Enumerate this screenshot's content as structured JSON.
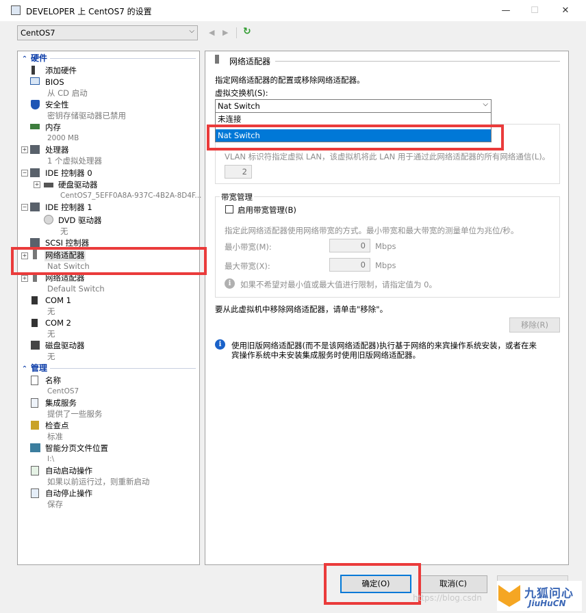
{
  "window": {
    "title": "DEVELOPER 上 CentOS7 的设置",
    "min": "—",
    "max": "☐",
    "close": "✕"
  },
  "vm_selector": {
    "value": "CentOS7"
  },
  "tree": {
    "hardware_header": "硬件",
    "mgmt_header": "管理",
    "items": [
      {
        "label": "添加硬件",
        "sub": ""
      },
      {
        "label": "BIOS",
        "sub": "从 CD 启动"
      },
      {
        "label": "安全性",
        "sub": "密钥存储驱动器已禁用"
      },
      {
        "label": "内存",
        "sub": "2000 MB"
      },
      {
        "label": "处理器",
        "sub": "1 个虚拟处理器"
      },
      {
        "label": "IDE 控制器 0",
        "sub": ""
      },
      {
        "label": "硬盘驱动器",
        "sub": "CentOS7_5EFF0A8A-937C-4B2A-8D4F..."
      },
      {
        "label": "IDE 控制器 1",
        "sub": ""
      },
      {
        "label": "DVD 驱动器",
        "sub": "无"
      },
      {
        "label": "SCSI 控制器",
        "sub": ""
      },
      {
        "label": "网络适配器",
        "sub": "Nat Switch"
      },
      {
        "label": "网络适配器",
        "sub": "Default Switch"
      },
      {
        "label": "COM 1",
        "sub": "无"
      },
      {
        "label": "COM 2",
        "sub": "无"
      },
      {
        "label": "磁盘驱动器",
        "sub": "无"
      }
    ],
    "mgmt_items": [
      {
        "label": "名称",
        "sub": "CentOS7"
      },
      {
        "label": "集成服务",
        "sub": "提供了一些服务"
      },
      {
        "label": "检查点",
        "sub": "标准"
      },
      {
        "label": "智能分页文件位置",
        "sub": "I:\\"
      },
      {
        "label": "自动启动操作",
        "sub": "如果以前运行过，则重新启动"
      },
      {
        "label": "自动停止操作",
        "sub": "保存"
      }
    ]
  },
  "adapter": {
    "section_title": "网络适配器",
    "desc": "指定网络适配器的配置或移除网络适配器。",
    "switch_label": "虚拟交换机(S):",
    "switch_value": "Nat Switch",
    "options": [
      "未连接",
      "Nat Switch"
    ],
    "vlan_desc": "VLAN 标识符指定虚拟 LAN，该虚拟机将此 LAN 用于通过此网络适配器的所有网络通信(L)。",
    "vlan_value": "2",
    "bw_title": "带宽管理",
    "bw_enable": "启用带宽管理(B)",
    "bw_desc": "指定此网络适配器使用网络带宽的方式。最小带宽和最大带宽的测量单位为兆位/秒。",
    "min_label": "最小带宽(M):",
    "max_label": "最大带宽(X):",
    "min_value": "0",
    "max_value": "0",
    "unit": "Mbps",
    "limit_note": "如果不希望对最小值或最大值进行限制，请指定值为 0。",
    "remove_desc": "要从此虚拟机中移除网络适配器，请单击\"移除\"。",
    "remove_btn": "移除(R)",
    "legacy_note_1": "使用旧版网络适配器(而不是该网络适配器)执行基于网络的来宾操作系统安装，或者在来",
    "legacy_note_2": "宾操作系统中未安装集成服务时使用旧版网络适配器。"
  },
  "buttons": {
    "ok": "确定(O)",
    "cancel": "取消(C)"
  },
  "watermark": {
    "text": "https://blog.csdn",
    "logo_cn": "九狐问心",
    "logo_en": "JiuHuCN"
  },
  "colors": {
    "accent": "#0078d7",
    "annotation_red": "#ea3b3b",
    "section_blue": "#0b3ca8"
  }
}
